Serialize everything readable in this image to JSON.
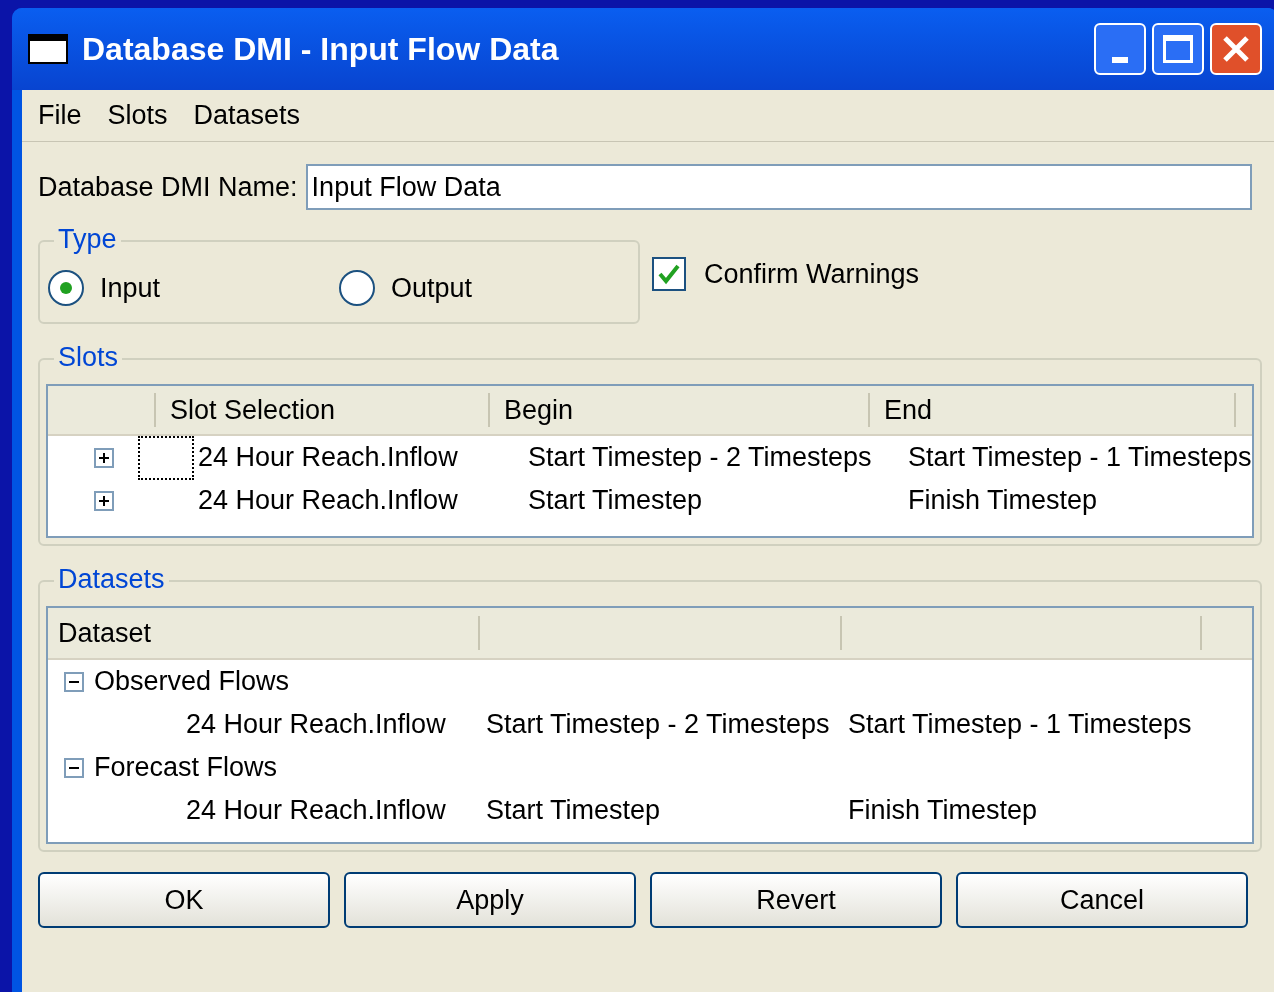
{
  "window": {
    "title": "Database DMI - Input Flow Data"
  },
  "menu": [
    "File",
    "Slots",
    "Datasets"
  ],
  "name_field": {
    "label": "Database DMI Name:",
    "value": "Input Flow Data"
  },
  "type_group": {
    "title": "Type",
    "options": [
      {
        "label": "Input",
        "selected": true
      },
      {
        "label": "Output",
        "selected": false
      }
    ]
  },
  "confirm_warnings": {
    "label": "Confirm Warnings",
    "checked": true
  },
  "slots": {
    "title": "Slots",
    "columns": [
      "Slot Selection",
      "Begin",
      "End"
    ],
    "rows": [
      {
        "expanded": false,
        "focused": true,
        "slot": "24 Hour Reach.Inflow",
        "begin": "Start Timestep - 2 Timesteps",
        "end": "Start Timestep - 1 Timesteps"
      },
      {
        "expanded": false,
        "focused": false,
        "slot": "24 Hour Reach.Inflow",
        "begin": "Start Timestep",
        "end": "Finish Timestep"
      }
    ]
  },
  "datasets": {
    "title": "Datasets",
    "column": "Dataset",
    "groups": [
      {
        "name": "Observed Flows",
        "expanded": true,
        "children": [
          {
            "slot": "24 Hour Reach.Inflow",
            "begin": "Start Timestep - 2 Timesteps",
            "end": "Start Timestep - 1 Timesteps"
          }
        ]
      },
      {
        "name": "Forecast Flows",
        "expanded": true,
        "children": [
          {
            "slot": "24 Hour Reach.Inflow",
            "begin": "Start Timestep",
            "end": "Finish Timestep"
          }
        ]
      }
    ]
  },
  "buttons": [
    "OK",
    "Apply",
    "Revert",
    "Cancel"
  ]
}
